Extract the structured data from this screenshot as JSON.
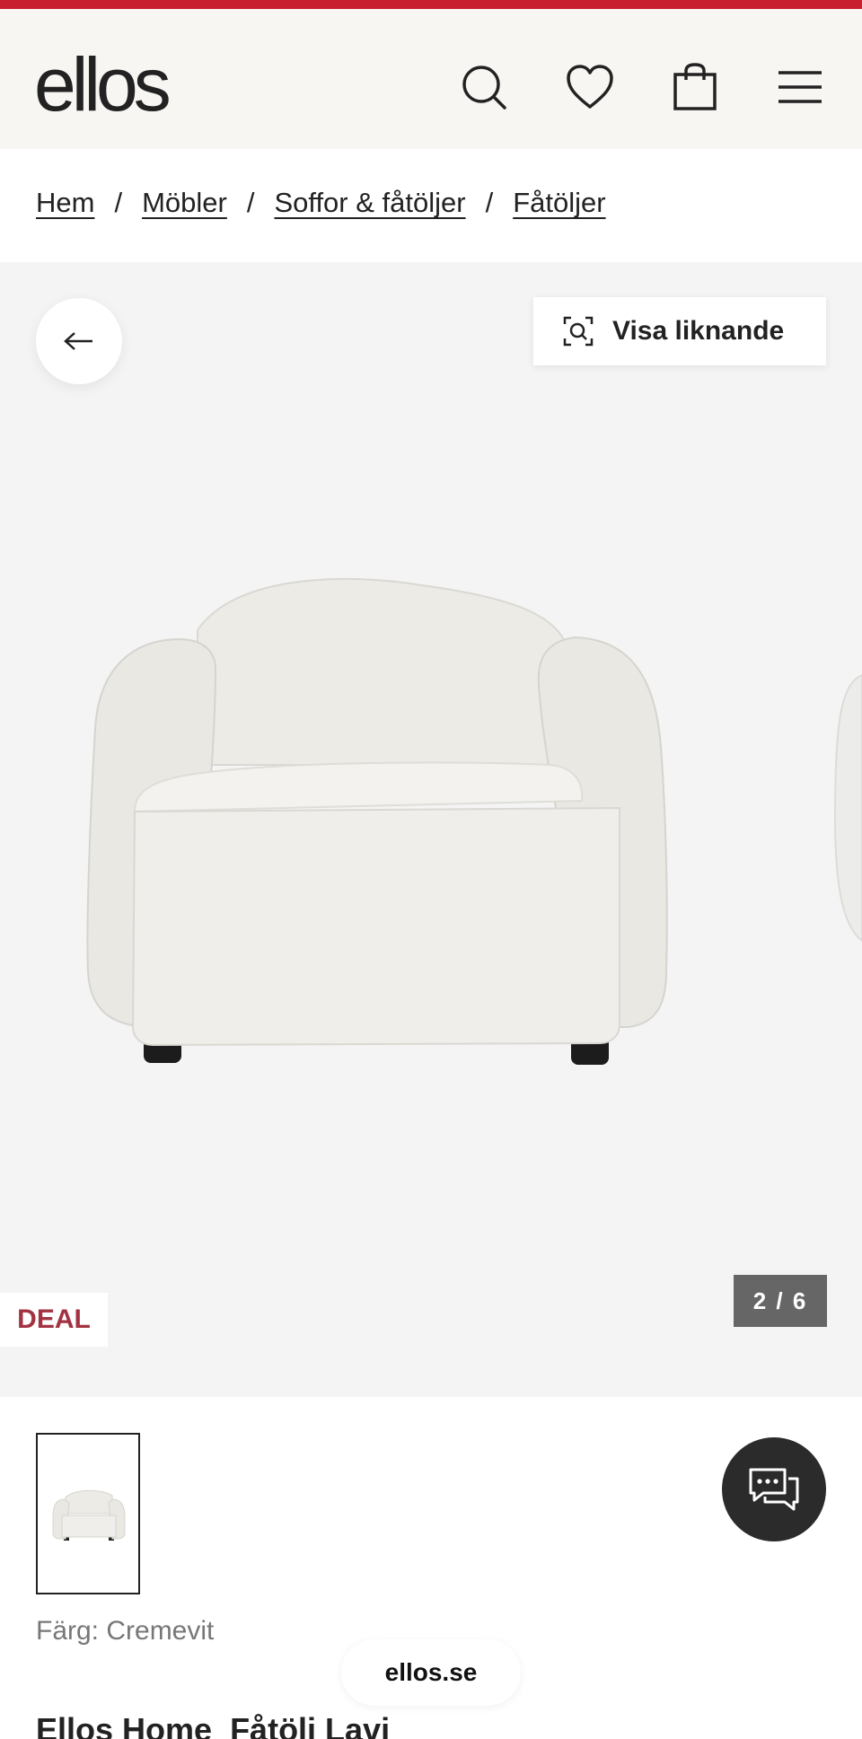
{
  "header": {
    "logo": "ellos",
    "icons": [
      "search-icon",
      "heart-icon",
      "bag-icon",
      "menu-icon"
    ]
  },
  "breadcrumb": [
    "Hem",
    "Möbler",
    "Soffor & fåtöljer",
    "Fåtöljer"
  ],
  "gallery": {
    "similar_label": "Visa liknande",
    "counter": "2 / 6",
    "badge": "DEAL"
  },
  "product": {
    "color_label": "Färg: Cremevit",
    "brand": "Ellos Home",
    "name": "Fåtölj Lavi"
  },
  "footer_pill": "ellos.se",
  "colors": {
    "accent": "#c8202f",
    "deal": "#a23340",
    "header_bg": "#f8f6f3",
    "gallery_bg": "#f4f4f4"
  }
}
